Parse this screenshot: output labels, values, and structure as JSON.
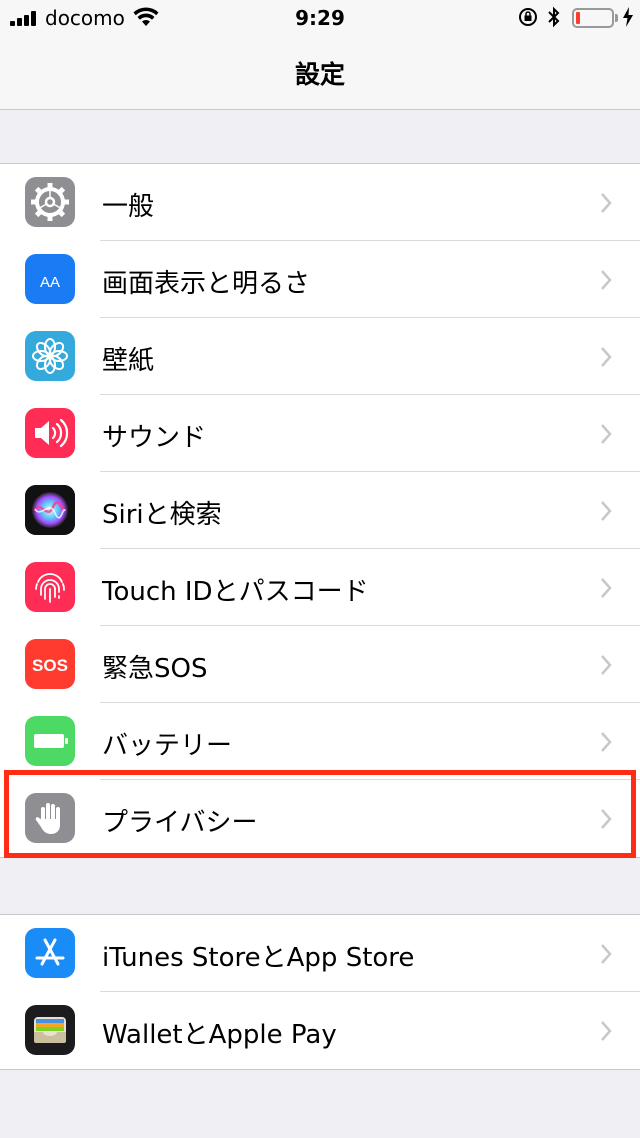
{
  "status_bar": {
    "carrier": "docomo",
    "time": "9:29",
    "battery_color": "#ff3b30"
  },
  "nav": {
    "title": "設定"
  },
  "groups": [
    {
      "items": [
        {
          "label": "一般",
          "icon": "gear-icon",
          "color": "#8e8e93"
        },
        {
          "label": "画面表示と明るさ",
          "icon": "display-brightness-icon",
          "icon_text": "AA",
          "color": "#1a7cf5"
        },
        {
          "label": "壁紙",
          "icon": "wallpaper-flower-icon",
          "color": "#34aadc"
        },
        {
          "label": "サウンド",
          "icon": "speaker-icon",
          "color": "#ff2d55"
        },
        {
          "label": "Siriと検索",
          "icon": "siri-icon",
          "color": "#1b1b3a"
        },
        {
          "label": "Touch IDとパスコード",
          "icon": "fingerprint-icon",
          "color": "#ff2d55"
        },
        {
          "label": "緊急SOS",
          "icon": "sos-icon",
          "icon_text": "SOS",
          "color": "#ff3b30"
        },
        {
          "label": "バッテリー",
          "icon": "battery-icon",
          "color": "#4cd964"
        },
        {
          "label": "プライバシー",
          "icon": "hand-icon",
          "color": "#8e8e93"
        }
      ]
    },
    {
      "items": [
        {
          "label": "iTunes StoreとApp Store",
          "icon": "app-store-icon",
          "color": "#1a8cf7"
        },
        {
          "label": "WalletとApple Pay",
          "icon": "wallet-icon",
          "color": "#1c1c1e"
        }
      ]
    }
  ],
  "highlight_color": "#ff2d16"
}
